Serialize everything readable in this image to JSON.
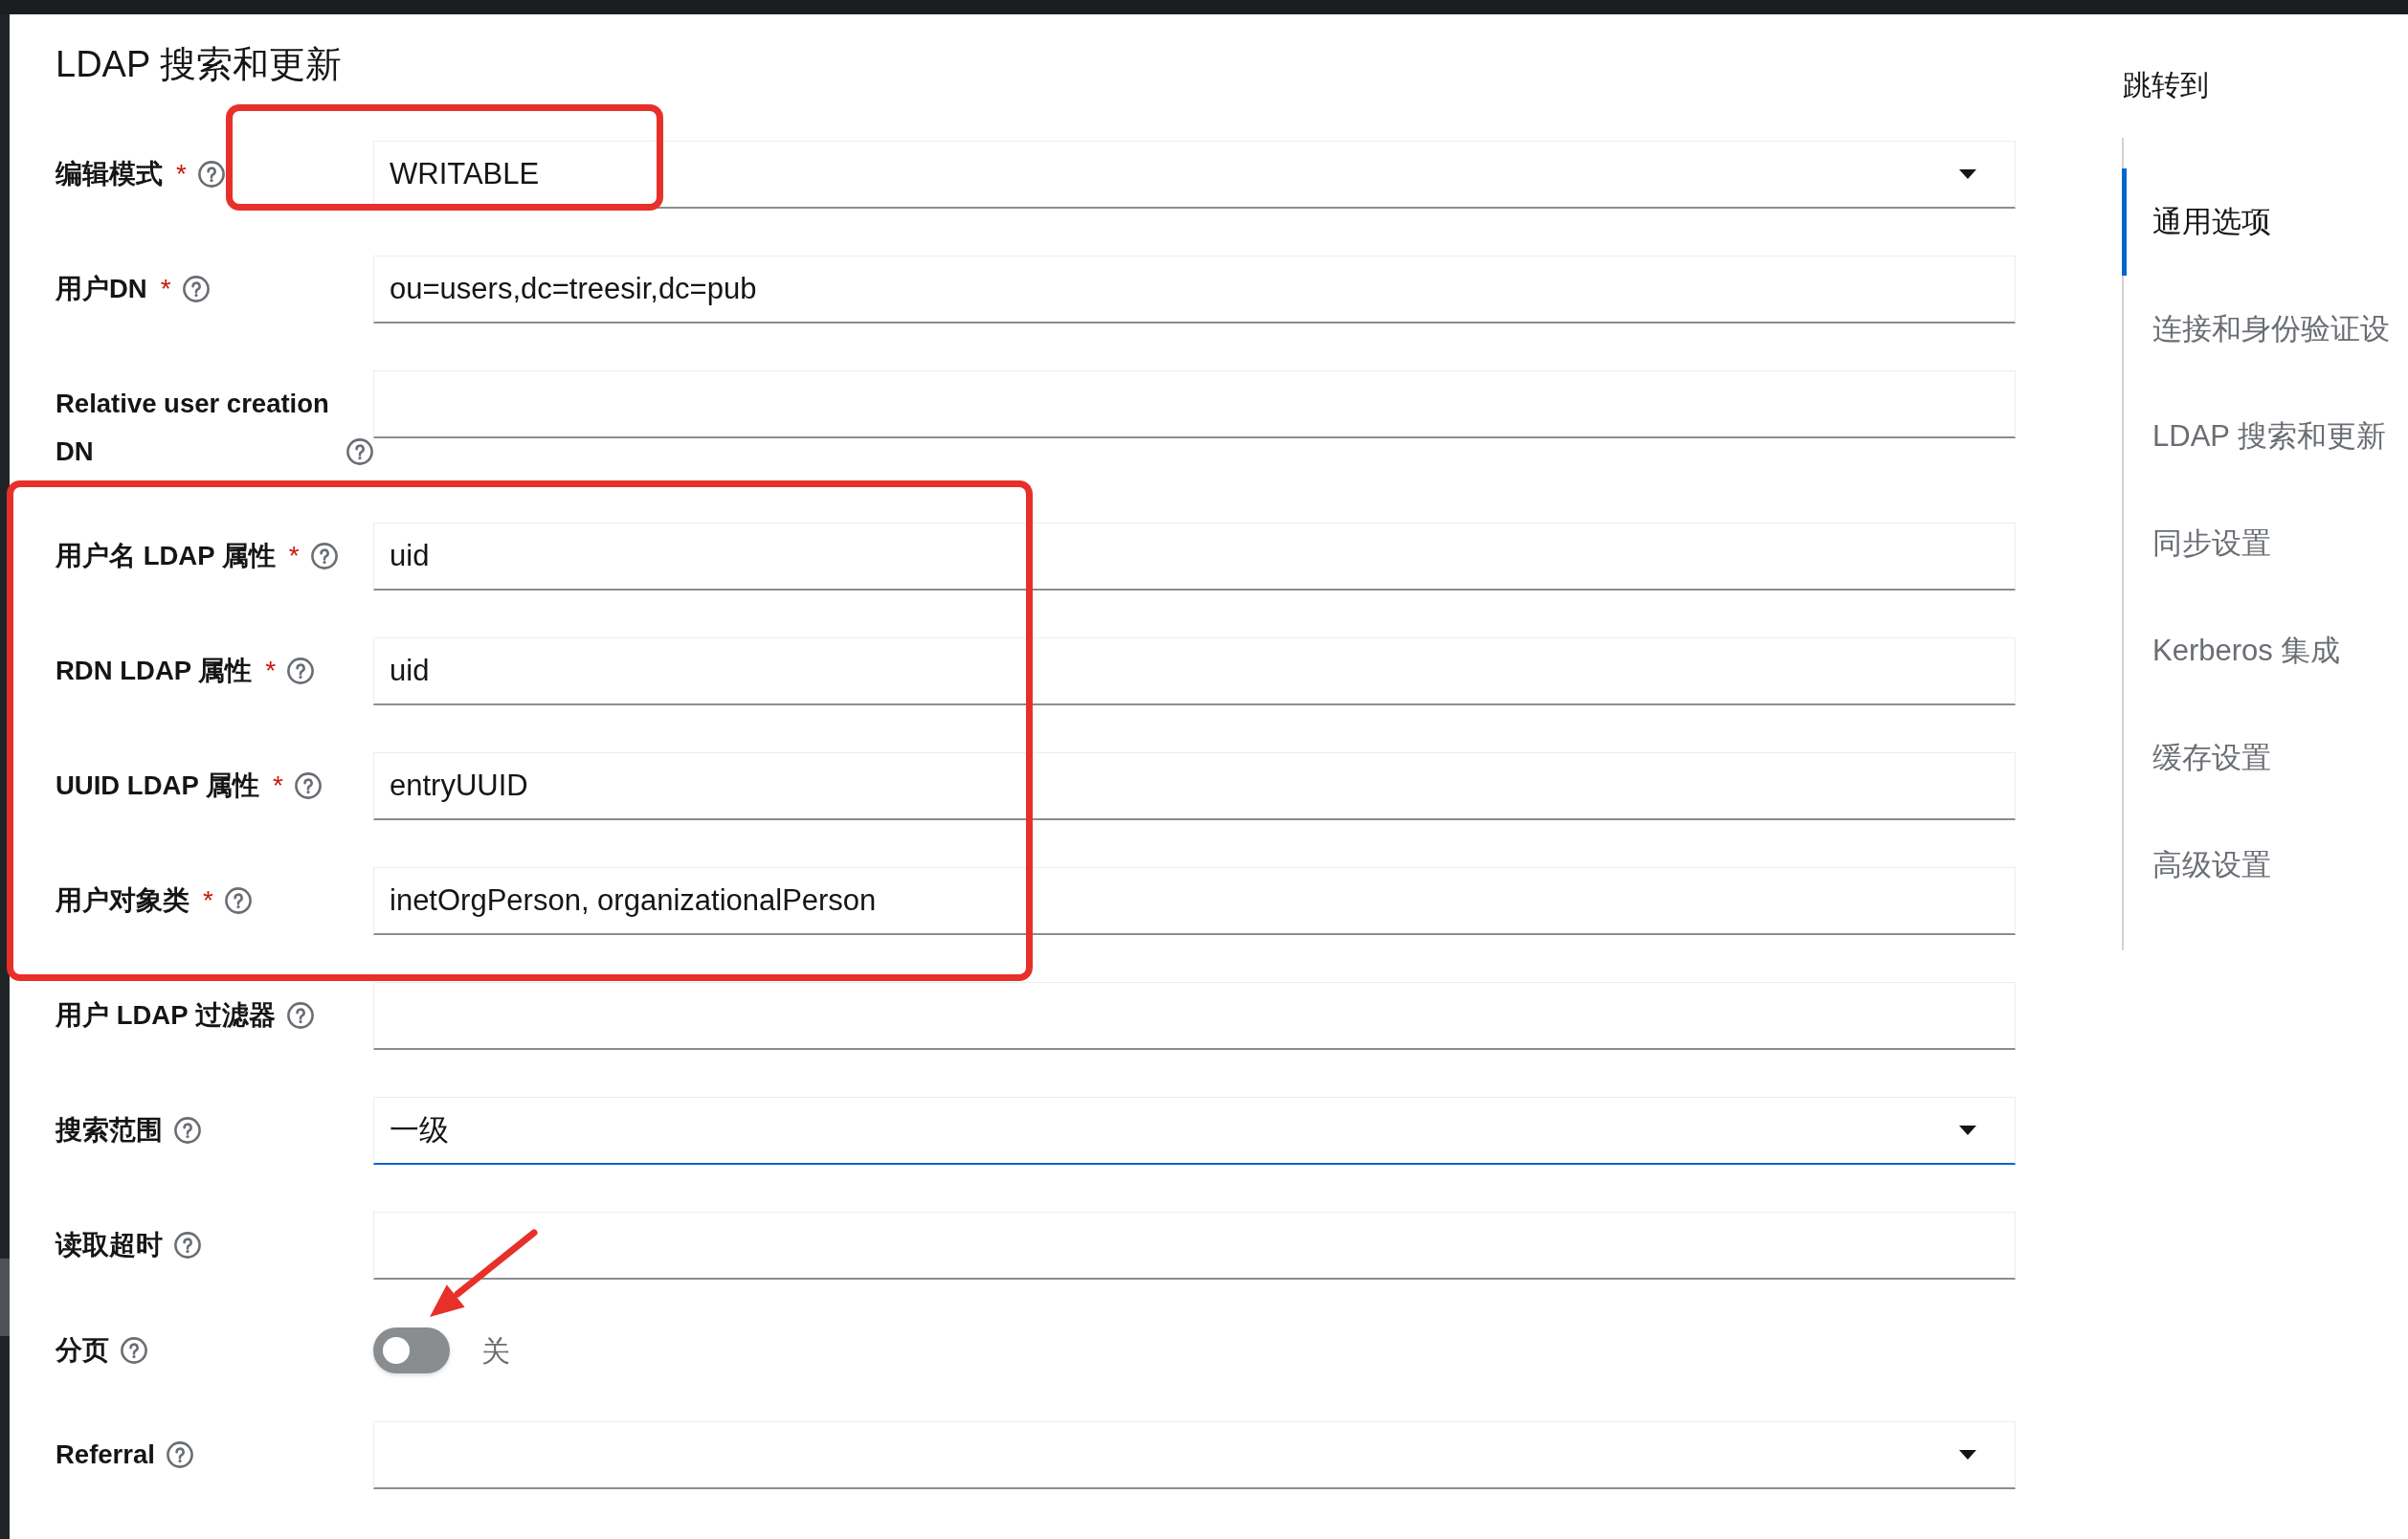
{
  "section": {
    "title": "LDAP 搜索和更新"
  },
  "fields": [
    {
      "kind": "select",
      "label": "编辑模式",
      "required_mark": "*",
      "value": "WRITABLE",
      "focused": false
    },
    {
      "kind": "text",
      "label": "用户DN",
      "required_mark": "*",
      "value": "ou=users,dc=treesir,dc=pub",
      "focused": false
    },
    {
      "kind": "text",
      "label": "Relative user creation DN",
      "focused": false
    },
    {
      "kind": "text",
      "label": "用户名 LDAP 属性",
      "required_mark": "*",
      "value": "uid",
      "focused": false
    },
    {
      "kind": "text",
      "label": "RDN LDAP 属性",
      "required_mark": "*",
      "value": "uid",
      "focused": false
    },
    {
      "kind": "text",
      "label": "UUID LDAP 属性",
      "required_mark": "*",
      "value": "entryUUID",
      "focused": false
    },
    {
      "kind": "text",
      "label": "用户对象类",
      "required_mark": "*",
      "value": "inetOrgPerson, organizationalPerson",
      "focused": false
    },
    {
      "kind": "text",
      "label": "用户 LDAP 过滤器",
      "focused": false
    },
    {
      "kind": "select",
      "label": "搜索范围",
      "value": "一级",
      "focused": true
    },
    {
      "kind": "text",
      "label": "读取超时",
      "focused": false
    },
    {
      "kind": "switch",
      "label": "分页",
      "on": false,
      "state_label": "关",
      "focused": false
    },
    {
      "kind": "select",
      "label": "Referral",
      "focused": false
    }
  ],
  "jump_nav": {
    "title": "跳转到",
    "items": [
      {
        "label": "通用选项",
        "selected": true
      },
      {
        "label": "连接和身份验证设",
        "selected": false
      },
      {
        "label": "LDAP 搜索和更新",
        "selected": false
      },
      {
        "label": "同步设置",
        "selected": false
      },
      {
        "label": "Kerberos 集成",
        "selected": false
      },
      {
        "label": "缓存设置",
        "selected": false
      },
      {
        "label": "高级设置",
        "selected": false
      }
    ]
  }
}
